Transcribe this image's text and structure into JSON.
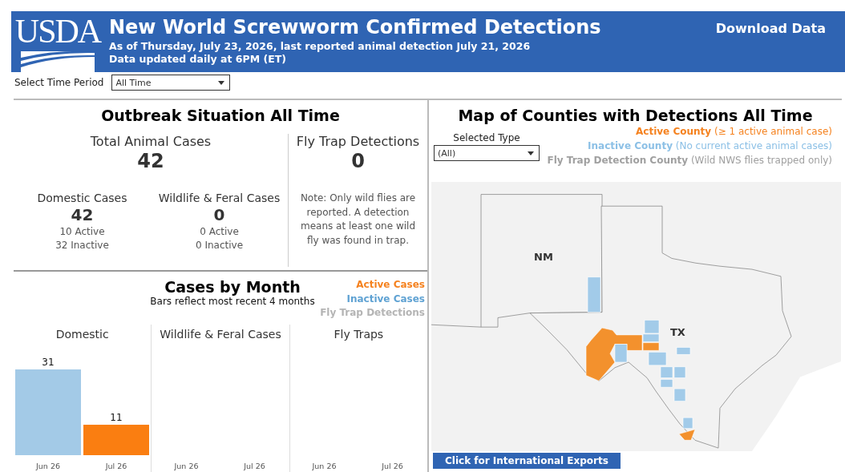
{
  "header": {
    "logo": "USDA",
    "title": "New World Screwworm Confirmed Detections",
    "subtitle_lines": [
      "As of Thursday, July 23, 2026, last reported animal detection July 21, 2026",
      "Data updated daily at 6PM (ET)"
    ],
    "download": "Download Data"
  },
  "filter": {
    "label": "Select Time Period",
    "value": "All Time"
  },
  "outbreak": {
    "title": "Outbreak Situation All Time",
    "total": {
      "label": "Total Animal Cases",
      "value": "42"
    },
    "groups": [
      {
        "label": "Domestic Cases",
        "value": "42",
        "lines": [
          "10 Active",
          "32 Inactive"
        ]
      },
      {
        "label": "Wildlife & Feral Cases",
        "value": "0",
        "lines": [
          "0 Active",
          "0 Inactive"
        ]
      }
    ],
    "fly_trap": {
      "label": "Fly Trap Detections",
      "value": "0",
      "note": "Note: Only wild flies are reported. A detection means at least one wild fly was found in trap."
    }
  },
  "cases_by_month": {
    "title": "Cases by Month",
    "subtitle": "Bars reflect most recent 4 months",
    "legend": [
      {
        "label": "Active Cases",
        "color": "#f5821f"
      },
      {
        "label": "Inactive Cases",
        "color": "#5fa2d3"
      },
      {
        "label": "Fly Trap Detections",
        "color": "#b4b4b4"
      }
    ],
    "panels": [
      {
        "title": "Domestic",
        "bar_active": [
          false,
          true
        ],
        "chart_data": {
          "type": "bar",
          "categories": [
            "Jun 26",
            "Jul 26"
          ],
          "values": [
            31,
            11
          ],
          "data_labels": true
        }
      },
      {
        "title": "Wildlife & Feral Cases",
        "months": [
          "Jun 26",
          "Jul 26"
        ]
      },
      {
        "title": "Fly Traps",
        "months": [
          "Jun 26",
          "Jul 26"
        ]
      }
    ]
  },
  "map": {
    "title": "Map of Counties with Detections All Time",
    "type_filter": {
      "label": "Selected Type",
      "value": "(All)"
    },
    "legend": [
      {
        "name": "Active County",
        "note": "(≥ 1 active animal case)",
        "color": "#f5821f"
      },
      {
        "name": "Inactive County",
        "note": "(No current active animal cases)",
        "color": "#8cc0e6"
      },
      {
        "name": "Fly Trap Detection County",
        "note": "(Wild NWS flies trapped only)",
        "color": "#a0a0a0"
      }
    ],
    "state_labels": [
      {
        "label": "NM"
      },
      {
        "label": "TX"
      }
    ],
    "export_button": "Click for International Exports"
  }
}
